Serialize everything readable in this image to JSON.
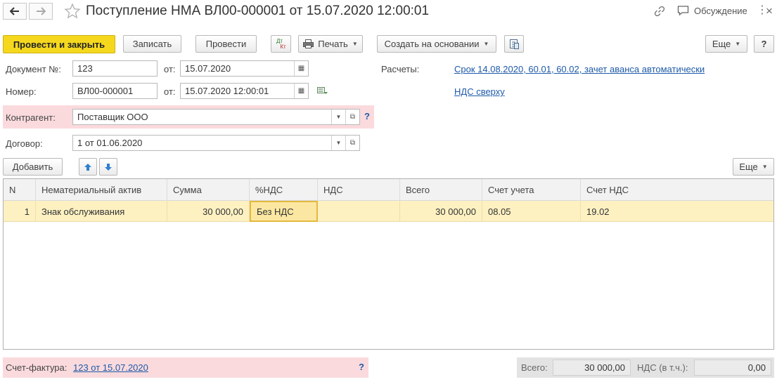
{
  "window": {
    "title": "Поступление НМА ВЛ00-000001 от 15.07.2020 12:00:01",
    "discussion_label": "Обсуждение"
  },
  "toolbar": {
    "post_close_label": "Провести и закрыть",
    "save_label": "Записать",
    "post_label": "Провести",
    "dtkt_top": "Дт",
    "dtkt_bottom": "Кт",
    "print_label": "Печать",
    "create_based_label": "Создать на основании",
    "more_label": "Еще",
    "help_label": "?"
  },
  "form": {
    "doc_no_label": "Документ №:",
    "doc_no_value": "123",
    "doc_from_label": "от:",
    "doc_date_value": "15.07.2020",
    "number_label": "Номер:",
    "number_value": "ВЛ00-000001",
    "number_from_label": "от:",
    "number_date_value": "15.07.2020 12:00:01",
    "settlements_label": "Расчеты:",
    "settlements_link": "Срок 14.08.2020, 60.01, 60.02, зачет аванса автоматически",
    "vat_link": "НДС сверху",
    "counterparty_label": "Контрагент:",
    "counterparty_value": "Поставщик ООО",
    "counterparty_help": "?",
    "contract_label": "Договор:",
    "contract_value": "1 от 01.06.2020"
  },
  "table_toolbar": {
    "add_label": "Добавить",
    "more_label": "Еще"
  },
  "table": {
    "columns": [
      "N",
      "Нематериальный актив",
      "Сумма",
      "%НДС",
      "НДС",
      "Всего",
      "Счет учета",
      "Счет НДС"
    ],
    "rows": [
      {
        "n": "1",
        "asset": "Знак обслуживания",
        "amount": "30 000,00",
        "vat_rate": "Без НДС",
        "vat": "",
        "total": "30 000,00",
        "account": "08.05",
        "vat_account": "19.02"
      }
    ]
  },
  "footer": {
    "invoice_label": "Счет-фактура:",
    "invoice_link": "123 от 15.07.2020",
    "invoice_help": "?",
    "total_label": "Всего:",
    "total_value": "30 000,00",
    "vat_label": "НДС (в т.ч.):",
    "vat_value": "0,00"
  },
  "colors": {
    "primary_button": "#f5d81e",
    "required_highlight": "#fadadd",
    "selected_row": "#fdf1c2",
    "link": "#1e5aa8"
  }
}
